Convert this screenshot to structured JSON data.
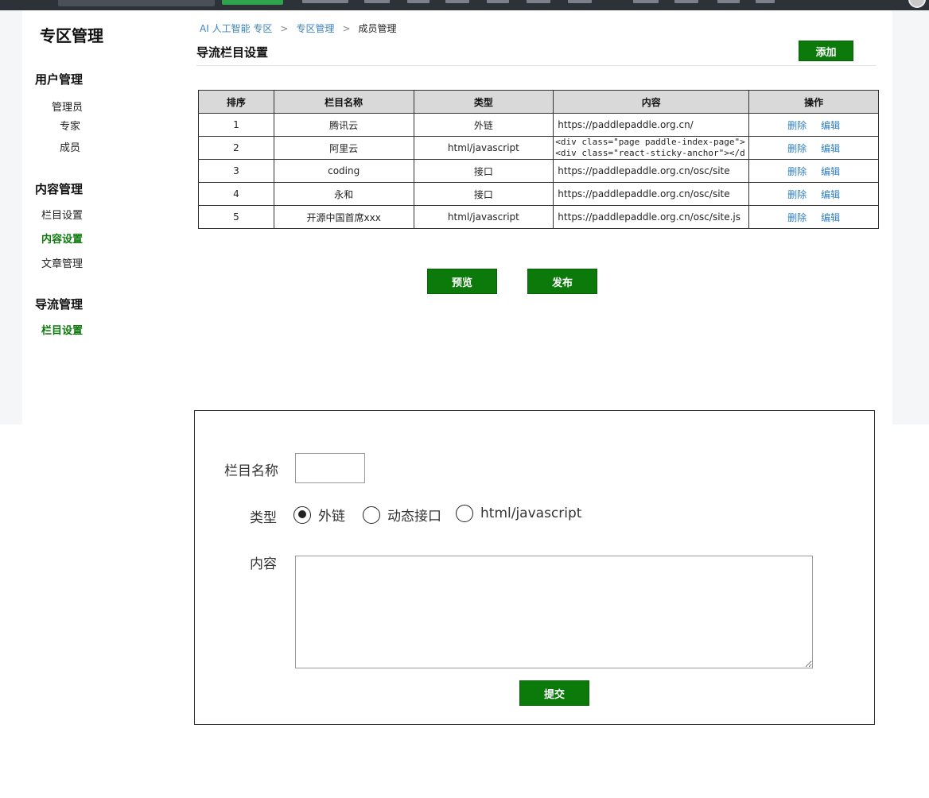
{
  "sidebar": {
    "title": "专区管理",
    "groups": [
      {
        "label": "用户管理",
        "items": [
          {
            "label": "管理员"
          },
          {
            "label": "专家"
          },
          {
            "label": "成员"
          }
        ]
      },
      {
        "label": "内容管理",
        "items": [
          {
            "label": "栏目设置"
          },
          {
            "label": "内容设置"
          },
          {
            "label": "文章管理"
          }
        ]
      },
      {
        "label": "导流管理",
        "items": [
          {
            "label": "栏目设置"
          }
        ]
      }
    ],
    "active_color": "#0e7a0d"
  },
  "breadcrumb": {
    "items": [
      "AI 人工智能 专区",
      "专区管理",
      "成员管理"
    ],
    "separator": ">"
  },
  "header": {
    "title": "导流栏目设置",
    "add_label": "添加"
  },
  "table": {
    "headers": [
      "排序",
      "栏目名称",
      "类型",
      "内容",
      "操作"
    ],
    "rows": [
      {
        "order": "1",
        "name": "腾讯云",
        "type": "外链",
        "content": "https://paddlepaddle.org.cn/"
      },
      {
        "order": "2",
        "name": "阿里云",
        "type": "html/javascript",
        "content": "<div class=\"page paddle-index-page\"><div class=\"react-sticky-anchor\"></div><div"
      },
      {
        "order": "3",
        "name": "coding",
        "type": "接口",
        "content": "https://paddlepaddle.org.cn/osc/site"
      },
      {
        "order": "4",
        "name": "永和",
        "type": "接口",
        "content": "https://paddlepaddle.org.cn/osc/site"
      },
      {
        "order": "5",
        "name": "开源中国首席xxx",
        "type": "html/javascript",
        "content": "https://paddlepaddle.org.cn/osc/site.js"
      }
    ],
    "delete_label": "删除",
    "edit_label": "编辑"
  },
  "actions": {
    "preview_label": "预览",
    "publish_label": "发布"
  },
  "form": {
    "name_label": "栏目名称",
    "name_value": "",
    "type_label": "类型",
    "type_options": [
      "外链",
      "动态接口",
      "html/javascript"
    ],
    "type_selected": "外链",
    "content_label": "内容",
    "content_value": "",
    "submit_label": "提交"
  },
  "colors": {
    "brand_green": "#0b7a0b",
    "link_blue": "#2f7fc6",
    "topbar": "#2d3138"
  }
}
